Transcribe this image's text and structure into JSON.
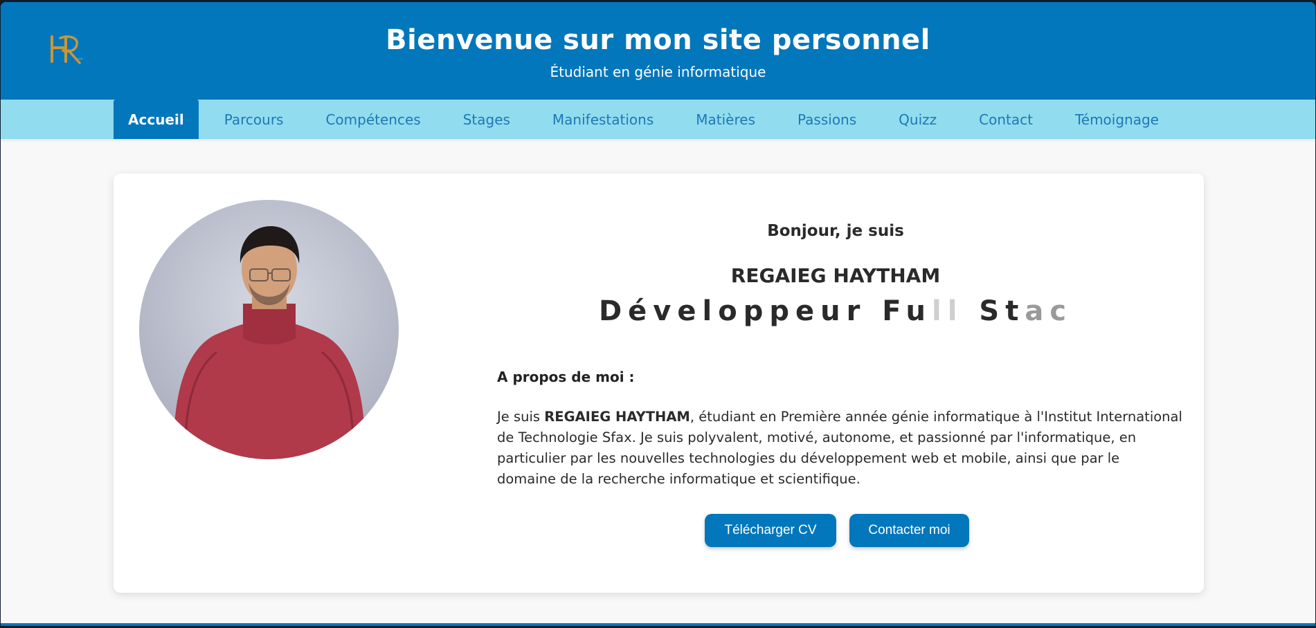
{
  "header": {
    "title": "Bienvenue sur mon site personnel",
    "subtitle": "Étudiant en génie informatique",
    "logo_text": "HR",
    "bg_color": "#0377bb"
  },
  "nav": {
    "items": [
      {
        "label": "Accueil",
        "active": true
      },
      {
        "label": "Parcours"
      },
      {
        "label": "Compétences"
      },
      {
        "label": "Stages"
      },
      {
        "label": "Manifestations"
      },
      {
        "label": "Matières"
      },
      {
        "label": "Passions"
      },
      {
        "label": "Quizz"
      },
      {
        "label": "Contact"
      },
      {
        "label": "Témoignage"
      }
    ],
    "bg_color": "#91dcef"
  },
  "profile": {
    "greeting": "Bonjour, je suis",
    "name": "REGAIEG HAYTHAM",
    "role_visible": "Développeur Fu",
    "role_fading_1": "ll",
    "role_space": " ",
    "role_visible_2": "St",
    "role_fading_2": "ac",
    "about_title": "A propos de moi :",
    "about_prefix": "Je suis ",
    "about_name": "REGAIEG HAYTHAM",
    "about_body": ", étudiant en Première année génie informatique à l'Institut International de Technologie Sfax. Je suis polyvalent, motivé, autonome, et passionné par l'informatique, en particulier par les nouvelles technologies du développement web et mobile, ainsi que par le domaine de la recherche informatique et scientifique.",
    "photo_icon": "profile-photo"
  },
  "buttons": {
    "download_cv": "Télécharger CV",
    "contact_me": "Contacter moi"
  }
}
